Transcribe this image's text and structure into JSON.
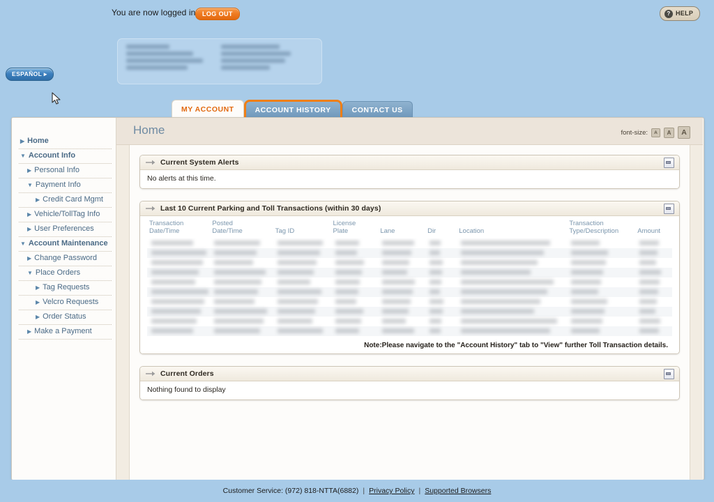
{
  "topbar": {
    "login_message": "You are now logged in.",
    "logout_label": "LOG OUT",
    "help_label": "HELP",
    "help_icon": "question-mark-icon"
  },
  "language_toggle": {
    "label": "ESPAÑOL ▸"
  },
  "account_block": {
    "redacted": true,
    "note": "blurred account summary block"
  },
  "tabs": [
    {
      "label": "MY ACCOUNT",
      "state": "active"
    },
    {
      "label": "ACCOUNT HISTORY",
      "state": "focused"
    },
    {
      "label": "CONTACT US",
      "state": "inactive"
    }
  ],
  "sidebar": {
    "items": [
      {
        "label": "Home",
        "level": 1,
        "expanded": false
      },
      {
        "label": "Account Info",
        "level": 1,
        "expanded": true
      },
      {
        "label": "Personal Info",
        "level": 2,
        "expanded": false
      },
      {
        "label": "Payment Info",
        "level": 2,
        "expanded": true
      },
      {
        "label": "Credit Card Mgmt",
        "level": 3,
        "expanded": false
      },
      {
        "label": "Vehicle/TollTag Info",
        "level": 2,
        "expanded": false
      },
      {
        "label": "User Preferences",
        "level": 2,
        "expanded": false
      },
      {
        "label": "Account Maintenance",
        "level": 1,
        "expanded": true
      },
      {
        "label": "Change Password",
        "level": 2,
        "expanded": false
      },
      {
        "label": "Place Orders",
        "level": 2,
        "expanded": true
      },
      {
        "label": "Tag Requests",
        "level": 3,
        "expanded": false
      },
      {
        "label": "Velcro Requests",
        "level": 3,
        "expanded": false
      },
      {
        "label": "Order Status",
        "level": 3,
        "expanded": false
      },
      {
        "label": "Make a Payment",
        "level": 2,
        "expanded": false
      }
    ]
  },
  "main": {
    "page_title": "Home",
    "font_size": {
      "label": "font-size:",
      "options": [
        "A",
        "A",
        "A"
      ]
    },
    "panels": [
      {
        "title": "Current System Alerts",
        "body_text": "No alerts at this time.",
        "collapse_icon": "minimize-icon"
      },
      {
        "title": "Last 10 Current Parking and Toll Transactions (within 30 days)",
        "collapse_icon": "minimize-icon",
        "columns": [
          "Transaction\nDate/Time",
          "Posted\nDate/Time",
          "Tag ID",
          "License\nPlate",
          "Lane",
          "Dir",
          "Location",
          "Transaction\nType/Description",
          "Amount"
        ],
        "rows_redacted": 10,
        "note": "Note:Please navigate to the \"Account History\" tab to \"View\" further Toll Transaction details."
      },
      {
        "title": "Current Orders",
        "body_text": "Nothing found to display",
        "collapse_icon": "minimize-icon"
      }
    ]
  },
  "footer": {
    "customer_service": "Customer Service: (972) 818-NTTA(6882)",
    "separator": "|",
    "privacy_policy": "Privacy Policy",
    "supported_browsers": "Supported Browsers"
  },
  "colors": {
    "page_background": "#a8cbe8",
    "accent_orange": "#e2690f",
    "tab_inactive": "#6d96ba",
    "panel_header": "#efe9dd",
    "beige": "#ece4da",
    "link_blue": "#4a6a86"
  }
}
